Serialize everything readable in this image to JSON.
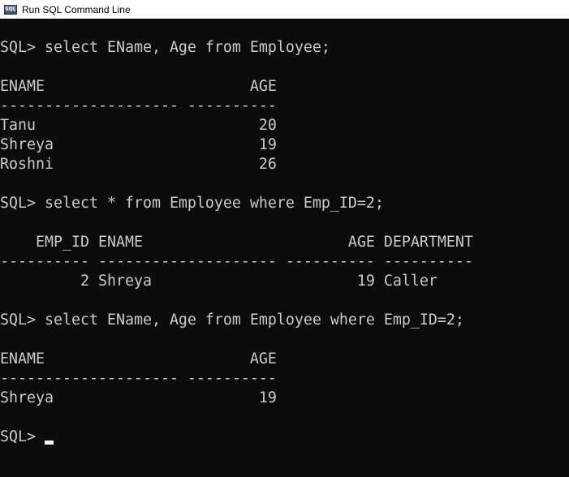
{
  "window": {
    "title": "Run SQL Command Line",
    "icon": "sql-app-icon"
  },
  "console": {
    "lines": [
      "",
      "SQL> select EName, Age from Employee;",
      "",
      "ENAME                       AGE",
      "-------------------- ----------",
      "Tanu                         20",
      "Shreya                       19",
      "Roshni                       26",
      "",
      "SQL> select * from Employee where Emp_ID=2;",
      "",
      "    EMP_ID ENAME                       AGE DEPARTMENT",
      "---------- -------------------- ---------- ----------",
      "         2 Shreya                       19 Caller",
      "",
      "SQL> select EName, Age from Employee where Emp_ID=2;",
      "",
      "ENAME                       AGE",
      "-------------------- ----------",
      "Shreya                       19",
      ""
    ],
    "prompt": "SQL> "
  }
}
